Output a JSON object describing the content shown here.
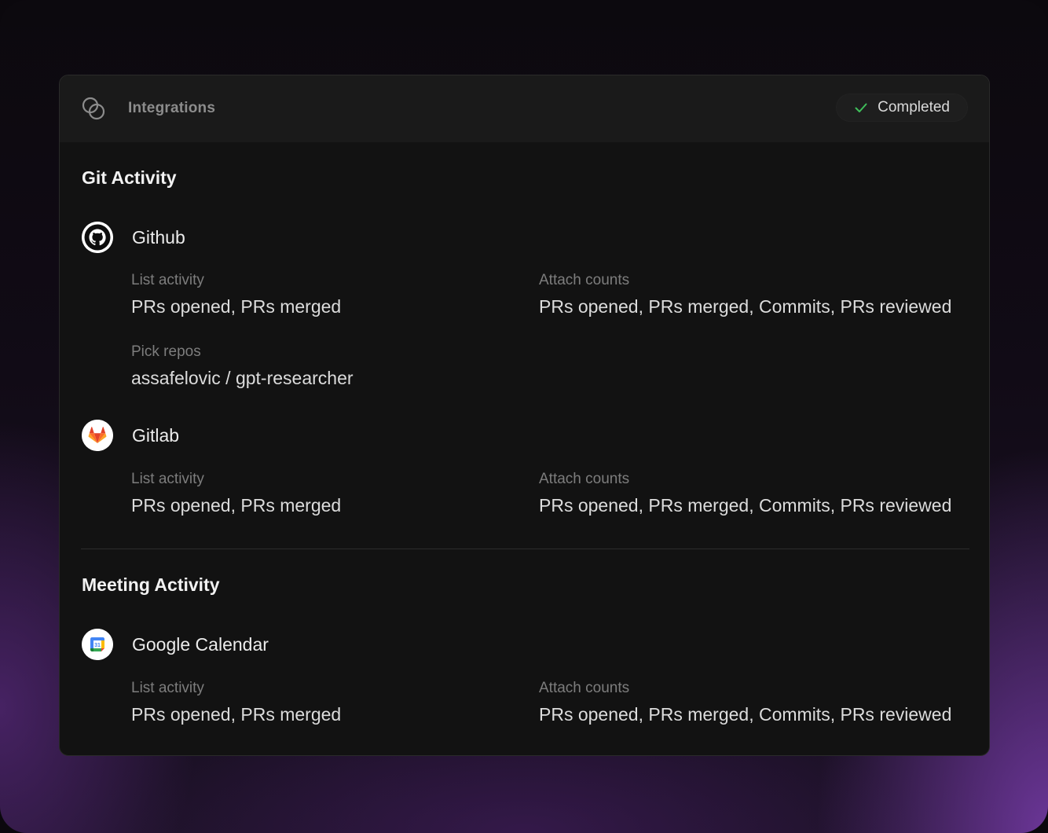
{
  "header": {
    "title": "Integrations",
    "icon": "integrations-icon",
    "status": "Completed",
    "status_color": "#3fbf5a"
  },
  "sections": [
    {
      "title": "Git Activity",
      "services": [
        {
          "name": "Github",
          "icon": "github-icon",
          "fields": [
            {
              "label": "List activity",
              "value": "PRs opened, PRs merged"
            },
            {
              "label": "Attach counts",
              "value": "PRs opened, PRs merged, Commits, PRs reviewed"
            },
            {
              "label": "Pick repos",
              "value": "assafelovic / gpt-researcher"
            }
          ]
        },
        {
          "name": "Gitlab",
          "icon": "gitlab-icon",
          "fields": [
            {
              "label": "List activity",
              "value": "PRs opened, PRs merged"
            },
            {
              "label": "Attach counts",
              "value": "PRs opened, PRs merged, Commits, PRs reviewed"
            }
          ]
        }
      ]
    },
    {
      "title": "Meeting Activity",
      "services": [
        {
          "name": "Google Calendar",
          "icon": "google-calendar-icon",
          "calendar_day": "31",
          "fields": [
            {
              "label": "List activity",
              "value": "PRs opened, PRs merged"
            },
            {
              "label": "Attach counts",
              "value": "PRs opened, PRs merged, Commits, PRs reviewed"
            }
          ]
        }
      ]
    }
  ]
}
